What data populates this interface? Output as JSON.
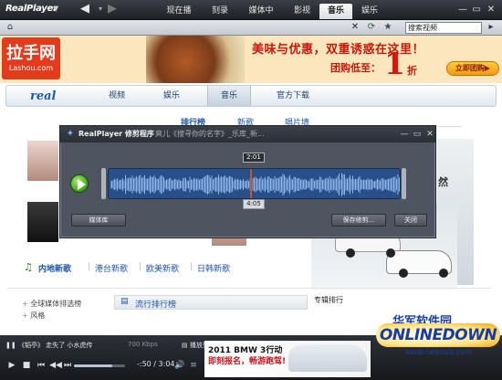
{
  "titlebar": {
    "logo": "RealPlayer",
    "tabs": [
      "现在播放",
      "刻录",
      "媒体中心",
      "影视",
      "音乐",
      "娱乐"
    ],
    "active_tab": "音乐"
  },
  "addressbar": {
    "search_value": "搜索视频"
  },
  "banner": {
    "brand": "拉手网",
    "url": "Lashou.com",
    "line1": "美味与优惠，双重诱惑在这里！",
    "line2": "团购低至：",
    "big_number": "1",
    "unit": "折",
    "cta": "立即团购▶"
  },
  "site_nav": {
    "logo": "real",
    "items": [
      "视频",
      "娱乐",
      "音乐",
      "官方下载"
    ],
    "active": "音乐"
  },
  "sub_nav": {
    "items": [
      "排行榜",
      "新歌",
      "唱片墙"
    ],
    "active": "排行榜"
  },
  "categories": {
    "items": [
      "内地新歌",
      "港台新歌",
      "欧美新歌",
      "日韩新歌"
    ],
    "note_icon": "music-note-icon"
  },
  "left_list": [
    "全球媒体排选榜",
    "风格"
  ],
  "rank": {
    "title": "流行排行榜",
    "album_title": "专辑排行"
  },
  "promo_snippet": "然",
  "dialog": {
    "title": "RealPlayer 修剪程序",
    "subtitle": "爽儿《搜寻你的名字》_乐库_新...",
    "time_current": "2:01",
    "time_total": "4:05",
    "buttons": {
      "media_library": "媒体库",
      "save_trimmed": "保存修剪...",
      "close": "关闭"
    },
    "progress_fraction": 0.49
  },
  "player": {
    "now_playing": "《韬亭》 走失了 小水虎传",
    "quality": "700 Kbps",
    "playlist_label": "播放列表",
    "time": "-:50 / 3:04",
    "seek_fraction": 0.75
  },
  "promo": {
    "line1": "2011 BMW 3行动",
    "line2": "即刻报名，畅游跑驾!"
  },
  "watermark": {
    "brand": "华军软件园",
    "logo": "ONLINEDOWN",
    "url": "www.newhua.com"
  },
  "colors": {
    "accent": "#1d56a8",
    "banner_red": "#c8170b",
    "dialog_bg": "#4e5560",
    "wave": "#2a4e8a"
  }
}
